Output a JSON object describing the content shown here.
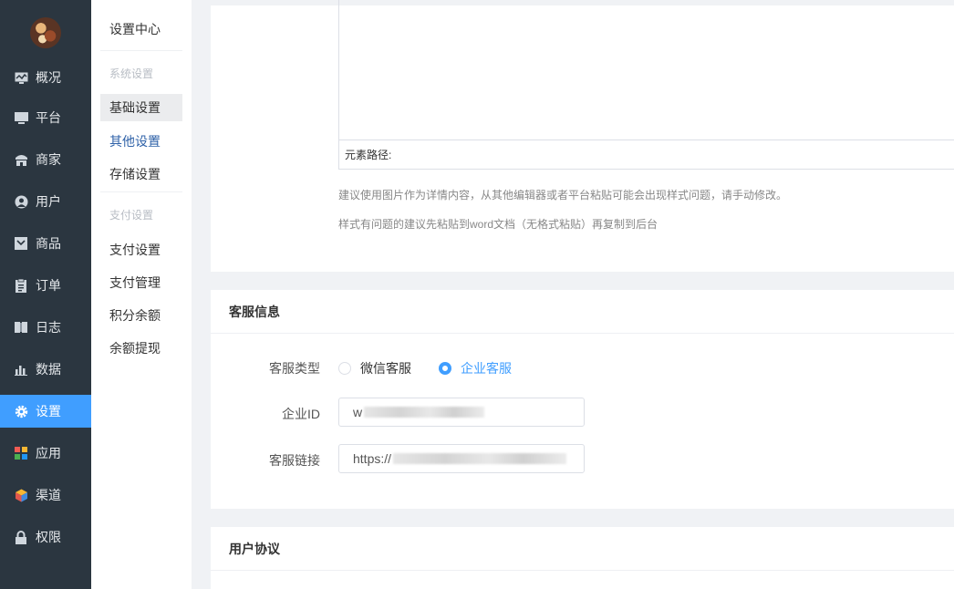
{
  "sidebar": {
    "items": [
      {
        "label": "概况",
        "icon": "dashboard-icon"
      },
      {
        "label": "平台",
        "icon": "monitor-icon"
      },
      {
        "label": "商家",
        "icon": "shop-icon"
      },
      {
        "label": "用户",
        "icon": "user-icon"
      },
      {
        "label": "商品",
        "icon": "goods-icon"
      },
      {
        "label": "订单",
        "icon": "clipboard-icon"
      },
      {
        "label": "日志",
        "icon": "book-icon"
      },
      {
        "label": "数据",
        "icon": "bar-chart-icon"
      },
      {
        "label": "设置",
        "icon": "gear-icon",
        "active": true
      },
      {
        "label": "应用",
        "icon": "apps-grid-icon"
      },
      {
        "label": "渠道",
        "icon": "cube-icon"
      },
      {
        "label": "权限",
        "icon": "lock-icon"
      }
    ],
    "accent": "#409eff",
    "background": "#2b3640"
  },
  "subnav": {
    "title": "设置中心",
    "group1": "系统设置",
    "items1": [
      "基础设置",
      "其他设置",
      "存储设置"
    ],
    "group2": "支付设置",
    "items2": [
      "支付设置",
      "支付管理",
      "积分余额",
      "余额提现"
    ]
  },
  "editor": {
    "path_label": "元素路径:",
    "hint1": "建议使用图片作为详情内容，从其他编辑器或者平台粘贴可能会出现样式问题，请手动修改。",
    "hint2": "样式有问题的建议先粘贴到word文档（无格式粘贴）再复制到后台"
  },
  "service": {
    "title": "客服信息",
    "type_label": "客服类型",
    "option_wechat": "微信客服",
    "option_enterprise": "企业客服",
    "selected": "企业客服",
    "id_label": "企业ID",
    "id_value": "w",
    "link_label": "客服链接",
    "link_value": "https://"
  },
  "agreement": {
    "title": "用户协议"
  }
}
